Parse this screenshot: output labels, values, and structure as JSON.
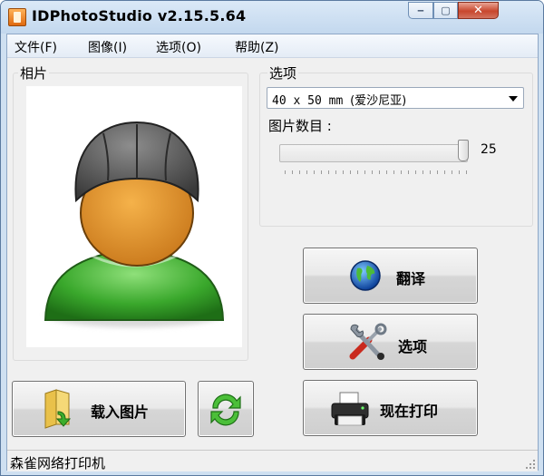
{
  "window": {
    "title": "IDPhotoStudio v2.15.5.64",
    "controls": {
      "minimize": "‒",
      "maximize": "▢",
      "close": "✕"
    }
  },
  "menu": {
    "items": [
      "文件(F)",
      "图像(I)",
      "选项(O)",
      "帮助(Z)"
    ]
  },
  "photo_panel": {
    "label": "相片",
    "placeholder_icon": "default-person-icon"
  },
  "options_panel": {
    "label": "选项",
    "format_select": {
      "value_latin": "40 x 50 mm ",
      "value_cjk": "(爱沙尼亚)"
    },
    "count_label": "图片数目 :",
    "count_slider": {
      "value": "25",
      "fill_fraction": 1.0
    }
  },
  "buttons": {
    "translate": {
      "label": "翻译",
      "icon": "globe-icon"
    },
    "options": {
      "label": "选项",
      "icon": "tools-icon"
    },
    "print": {
      "label": "现在打印",
      "icon": "printer-icon"
    },
    "load": {
      "label": "载入图片",
      "icon": "folder-icon"
    },
    "refresh": {
      "icon": "refresh-icon"
    }
  },
  "status": {
    "printer": "森雀网络打印机"
  }
}
